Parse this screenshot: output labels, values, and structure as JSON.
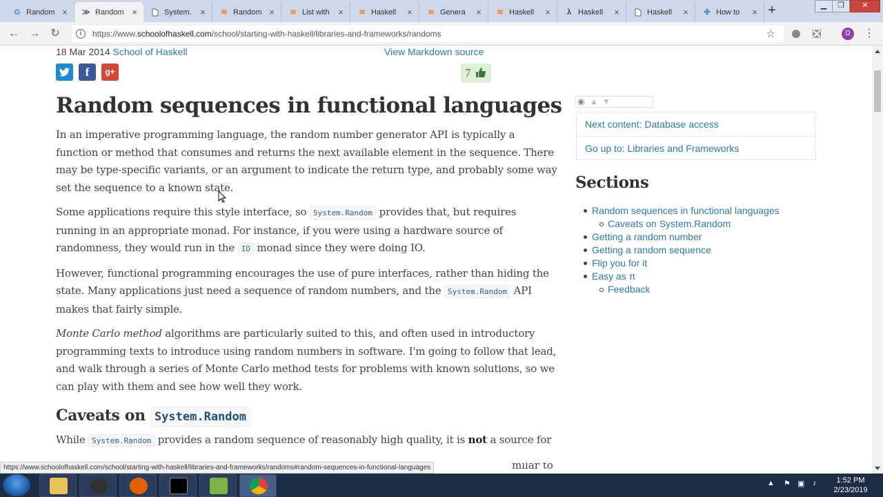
{
  "browser": {
    "tabs": [
      {
        "title": "Random",
        "icon": "google-icon",
        "active": false
      },
      {
        "title": "Random",
        "icon": "haskell-icon",
        "active": true
      },
      {
        "title": "System.",
        "icon": "page-icon",
        "active": false
      },
      {
        "title": "Random",
        "icon": "stackoverflow-icon",
        "active": false
      },
      {
        "title": "List with",
        "icon": "stackoverflow-icon",
        "active": false
      },
      {
        "title": "Haskell",
        "icon": "stackoverflow-icon",
        "active": false
      },
      {
        "title": "Genera",
        "icon": "stackoverflow-icon",
        "active": false
      },
      {
        "title": "Haskell",
        "icon": "stackoverflow-icon",
        "active": false
      },
      {
        "title": "Haskell",
        "icon": "hackage-icon",
        "active": false
      },
      {
        "title": "Haskell",
        "icon": "page-icon",
        "active": false
      },
      {
        "title": "How to",
        "icon": "puzzle-icon",
        "active": false
      }
    ],
    "url_prefix": "https://www.",
    "url_domain": "schoolofhaskell.com",
    "url_path": "/school/starting-with-haskell/libraries-and-frameworks/randoms",
    "profile_initial": "D"
  },
  "page": {
    "date": "18 Mar 2014",
    "author": "School of Haskell",
    "markdown_link": "View Markdown source",
    "vote_count": "7",
    "title": "Random sequences in functional languages",
    "p1": "In an imperative programming language, the random number generator API is typically a function or method that consumes and returns the next available element in the sequence. There may be type-specific variants, or an argument to indicate the return type, and probably some way set the sequence to a known state.",
    "p2_a": "Some applications require this style interface, so ",
    "p2_code1": "System.Random",
    "p2_b": " provides that, but requires running in an appropriate monad. For instance, if you were using a hardware source of randomness, they would run in the ",
    "p2_code2": "IO",
    "p2_c": " monad since they were doing IO.",
    "p3_a": "However, functional programming encourages the use of pure interfaces, rather than hiding the state. Many applications just need a sequence of random numbers, and the ",
    "p3_code": "System.Random",
    "p3_b": " API makes that fairly simple.",
    "p4_em": "Monte Carlo method",
    "p4_rest": " algorithms are particularly suited to this, and often used in introductory programming texts to introduce using random numbers in software. I'm going to follow that lead, and walk through a series of Monte Carlo method tests for problems with known solutions, so we can play with them and see how well they work.",
    "h2_text": "Caveats on ",
    "h2_code": "System.Random",
    "p5_a": "While ",
    "p5_code": "System.Random",
    "p5_b": " provides a random sequence of reasonably high quality, it is ",
    "p5_bold": "not",
    "p5_c": " a source for",
    "p6_fragment": "milar to"
  },
  "sidebar": {
    "next_content": "Next content: Database access",
    "go_up": "Go up to: Libraries and Frameworks",
    "sections_title": "Sections",
    "toc": [
      {
        "label": "Random sequences in functional languages",
        "sub": false
      },
      {
        "label": "Caveats on System.Random",
        "sub": true
      },
      {
        "label": "Getting a random number",
        "sub": false
      },
      {
        "label": "Getting a random sequence",
        "sub": false
      },
      {
        "label": "Flip you for it",
        "sub": false
      },
      {
        "label": "Easy as π",
        "sub": false
      },
      {
        "label": "Feedback",
        "sub": true
      }
    ]
  },
  "status_url": "https://www.schoolofhaskell.com/school/starting-with-haskell/libraries-and-frameworks/randoms#random-sequences-in-functional-languages",
  "taskbar": {
    "time": "1:52 PM",
    "date": "2/23/2019"
  },
  "colors": {
    "link": "#2a7ab0",
    "twitter": "#1d8bd1",
    "facebook": "#3b5998",
    "google_plus": "#d34836",
    "vote_bg": "#dff0d8"
  }
}
